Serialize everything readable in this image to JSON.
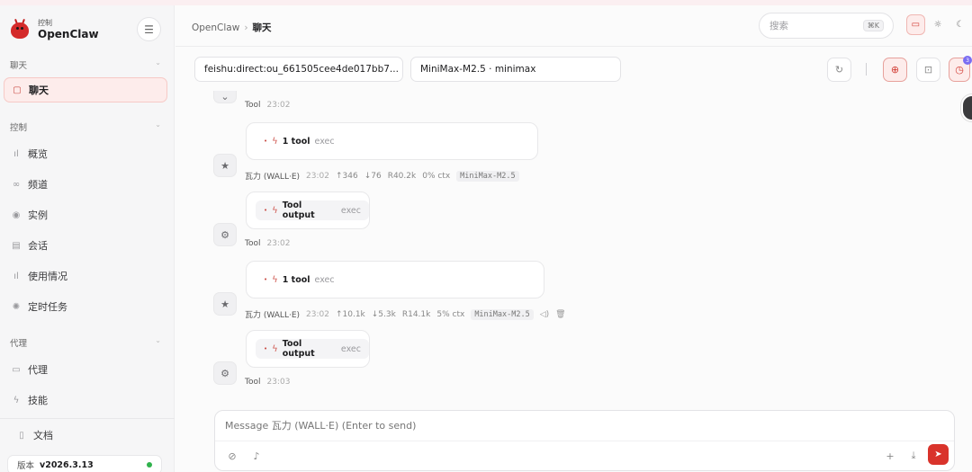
{
  "brand": {
    "subtitle": "控制",
    "name": "OpenClaw"
  },
  "sidebar": {
    "groups": {
      "chat": "聊天",
      "control": "控制",
      "agent": "代理"
    },
    "items": {
      "chat": "聊天",
      "overview": "概览",
      "channels": "频道",
      "instances": "实例",
      "sessions": "会话",
      "usage": "使用情况",
      "cron": "定时任务",
      "agents": "代理",
      "skills": "技能",
      "docs": "文档"
    },
    "version_label": "版本",
    "version": "v2026.3.13",
    "status_color": "#2fb24c"
  },
  "header": {
    "breadcrumb_root": "OpenClaw",
    "breadcrumb_current": "聊天",
    "search_placeholder": "搜索",
    "search_shortcut": "⌘K",
    "accent": "#d9332b"
  },
  "toolbar": {
    "session": "feishu:direct:ou_661505cee4de017bb7...",
    "model": "MiniMax-M2.5 · minimax",
    "notification_count": "3"
  },
  "messages": [
    {
      "role": "Tool",
      "time": "23:02"
    },
    {
      "pill_label": "1 tool",
      "pill_kind": "exec"
    },
    {
      "role": "瓦力 (WALL·E)",
      "time": "23:02",
      "stats": [
        "↑346",
        "↓76",
        "R40.2k",
        "0% ctx"
      ],
      "model": "MiniMax-M2.5"
    },
    {
      "pill_label": "Tool output",
      "pill_kind": "exec"
    },
    {
      "role": "Tool",
      "time": "23:02"
    },
    {
      "pill_label": "1 tool",
      "pill_kind": "exec"
    },
    {
      "role": "瓦力 (WALL·E)",
      "time": "23:02",
      "stats": [
        "↑10.1k",
        "↓5.3k",
        "R14.1k",
        "5% ctx"
      ],
      "model": "MiniMax-M2.5"
    },
    {
      "pill_label": "Tool output",
      "pill_kind": "exec"
    },
    {
      "role": "Tool",
      "time": "23:03"
    }
  ],
  "composer": {
    "placeholder": "Message 瓦力 (WALL·E) (Enter to send)"
  }
}
